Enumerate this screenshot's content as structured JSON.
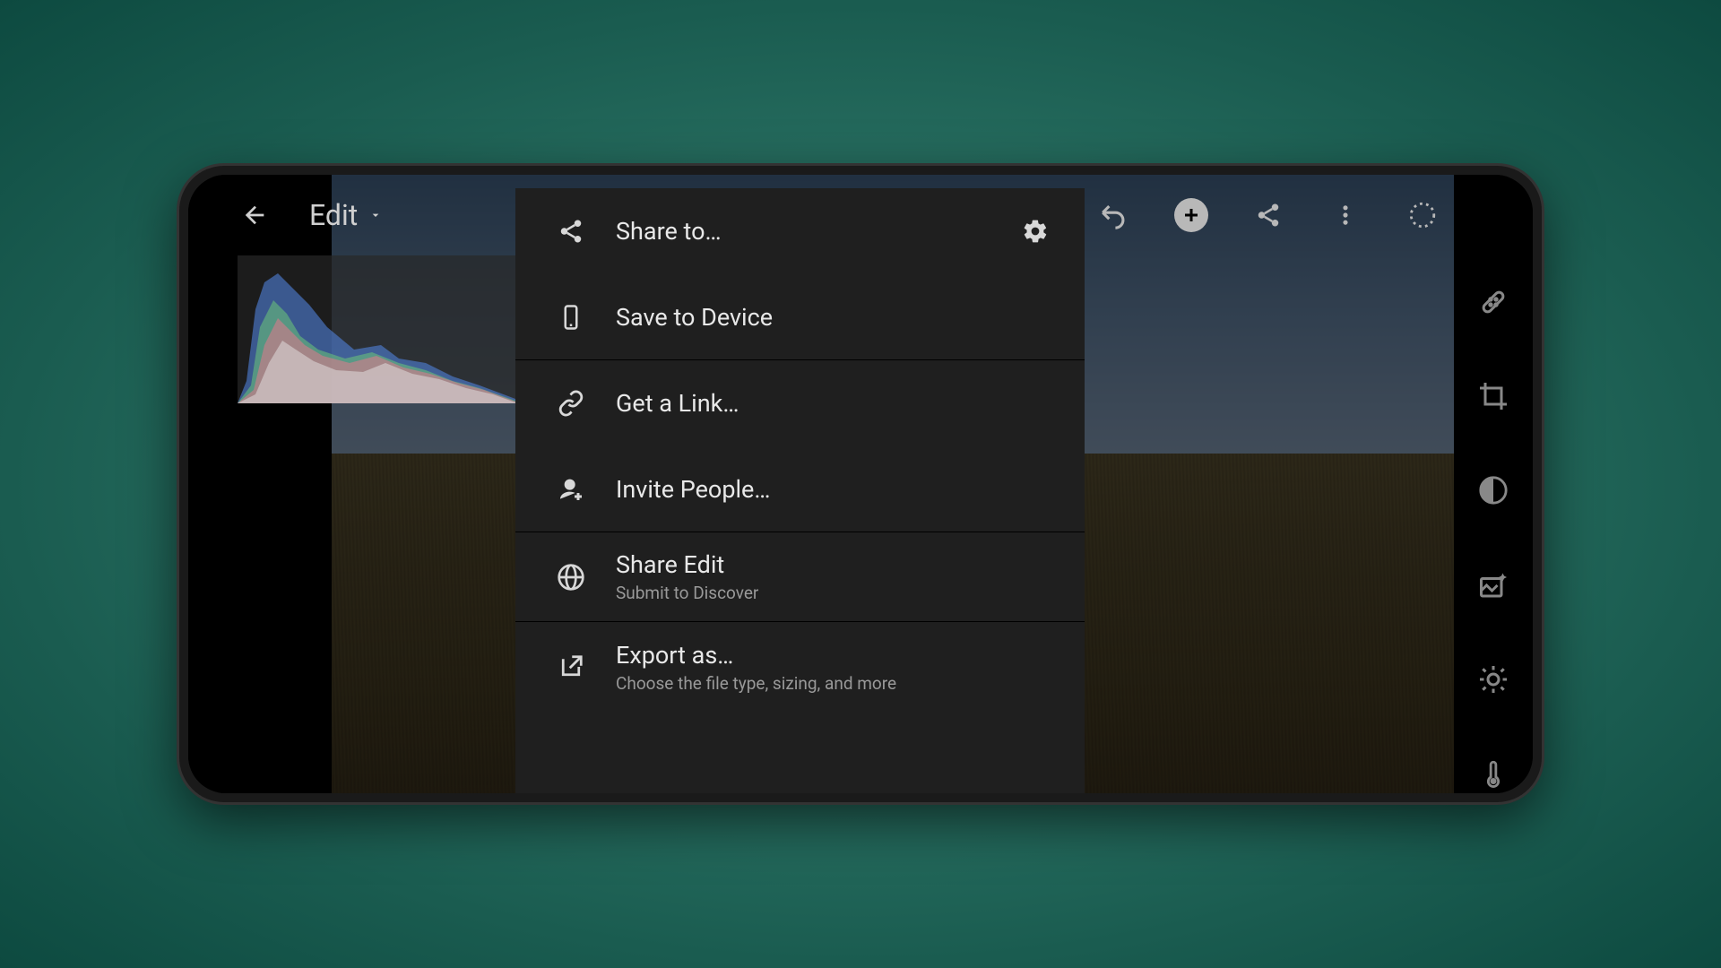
{
  "header": {
    "edit_label": "Edit"
  },
  "share_menu": {
    "share_to": "Share to…",
    "save_device": "Save to Device",
    "get_link": "Get a Link…",
    "invite_people": "Invite People…",
    "share_edit_title": "Share Edit",
    "share_edit_sub": "Submit to Discover",
    "export_title": "Export as…",
    "export_sub": "Choose the file type, sizing, and more"
  }
}
